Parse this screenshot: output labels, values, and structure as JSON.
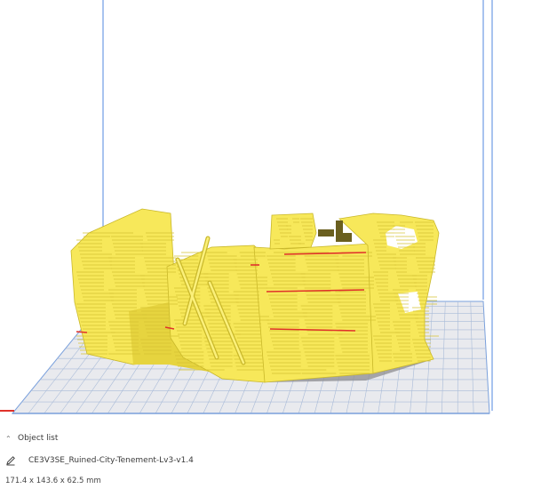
{
  "panel": {
    "object_list_label": "Object list",
    "object_name": "CE3V3SE_Ruined-City-Tenement-Lv3-v1.4",
    "dimensions": "171.4 x 143.6 x 62.5 mm",
    "icons": {
      "toggle": "chevron-up-icon",
      "edit": "pencil-icon"
    }
  },
  "viewport": {
    "colors": {
      "background": "#ffffff",
      "build_volume_edge": "#6f9be4",
      "grid_fill": "#e9eaee",
      "grid_line": "#a9bbd8",
      "model": "#f7e85a",
      "model_shade": "#cfbe2e",
      "model_line": "#d4c233",
      "overhang": "#e0322a",
      "shadow": "#8c8c90"
    }
  }
}
